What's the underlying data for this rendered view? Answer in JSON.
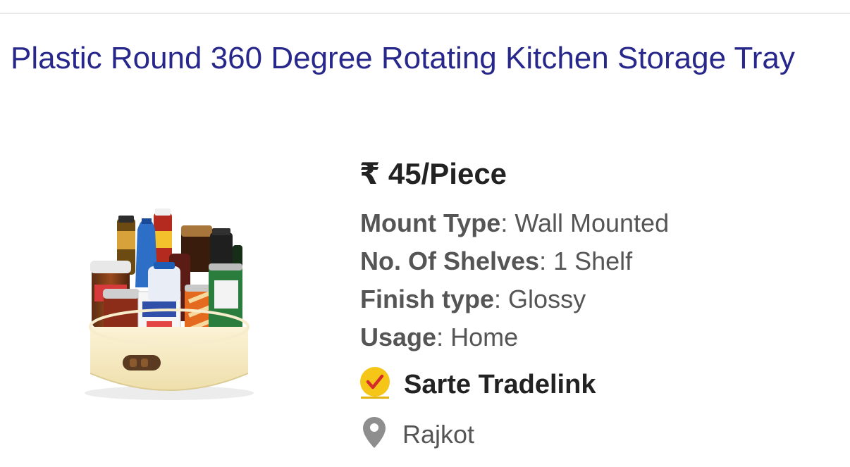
{
  "product": {
    "title": "Plastic Round 360 Degree Rotating Kitchen Storage Tray",
    "image_alt": "Plastic Round 360 Degree Rotating Kitchen Storage Tray",
    "price": "₹ 45/Piece"
  },
  "specs": [
    {
      "label": "Mount Type",
      "value": "Wall Mounted"
    },
    {
      "label": "No. Of Shelves",
      "value": "1 Shelf"
    },
    {
      "label": "Finish type",
      "value": "Glossy"
    },
    {
      "label": "Usage",
      "value": "Home"
    }
  ],
  "seller": {
    "name": "Sarte Tradelink",
    "badge_icon": "verified-check-icon",
    "badge_color": "#f5c518",
    "check_color": "#d62b2b"
  },
  "location": {
    "city": "Rajkot",
    "icon": "location-pin-icon"
  },
  "colors": {
    "title": "#28278c",
    "price": "#222222",
    "spec_text": "#555555"
  }
}
